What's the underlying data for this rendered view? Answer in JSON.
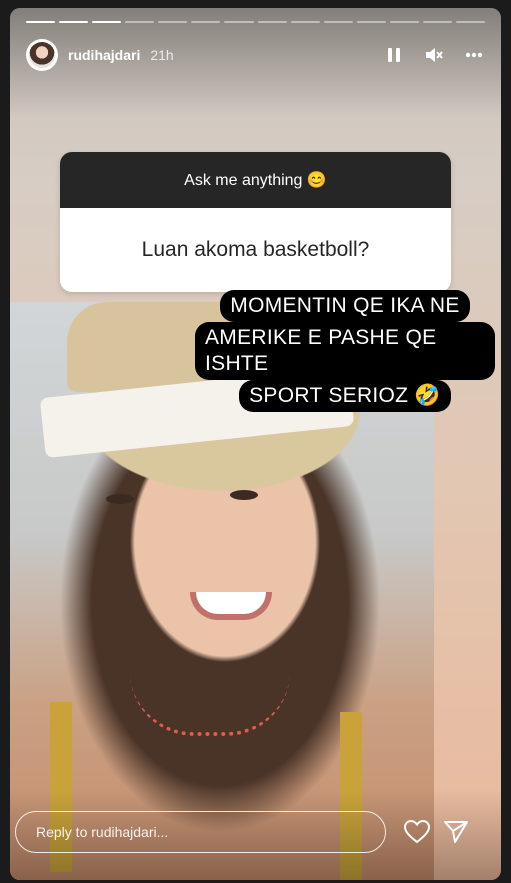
{
  "story": {
    "progress_segments": 14,
    "progress_filled": 3,
    "username": "rudihajdari",
    "time": "21h"
  },
  "icons": {
    "pause": "pause-icon",
    "mute": "speaker-muted-icon",
    "more": "more-horizontal-icon",
    "heart": "heart-icon",
    "send": "send-icon"
  },
  "question_sticker": {
    "prompt": "Ask me anything 😊",
    "question": "Luan akoma basketboll?"
  },
  "answer_text": [
    "MOMENTIN QE IKA NE",
    "AMERIKE E PASHE QE ISHTE",
    "SPORT SERIOZ 🤣"
  ],
  "reply": {
    "placeholder": "Reply to rudihajdari..."
  },
  "colors": {
    "sticker_header": "#262626",
    "text_bg": "#000000"
  }
}
